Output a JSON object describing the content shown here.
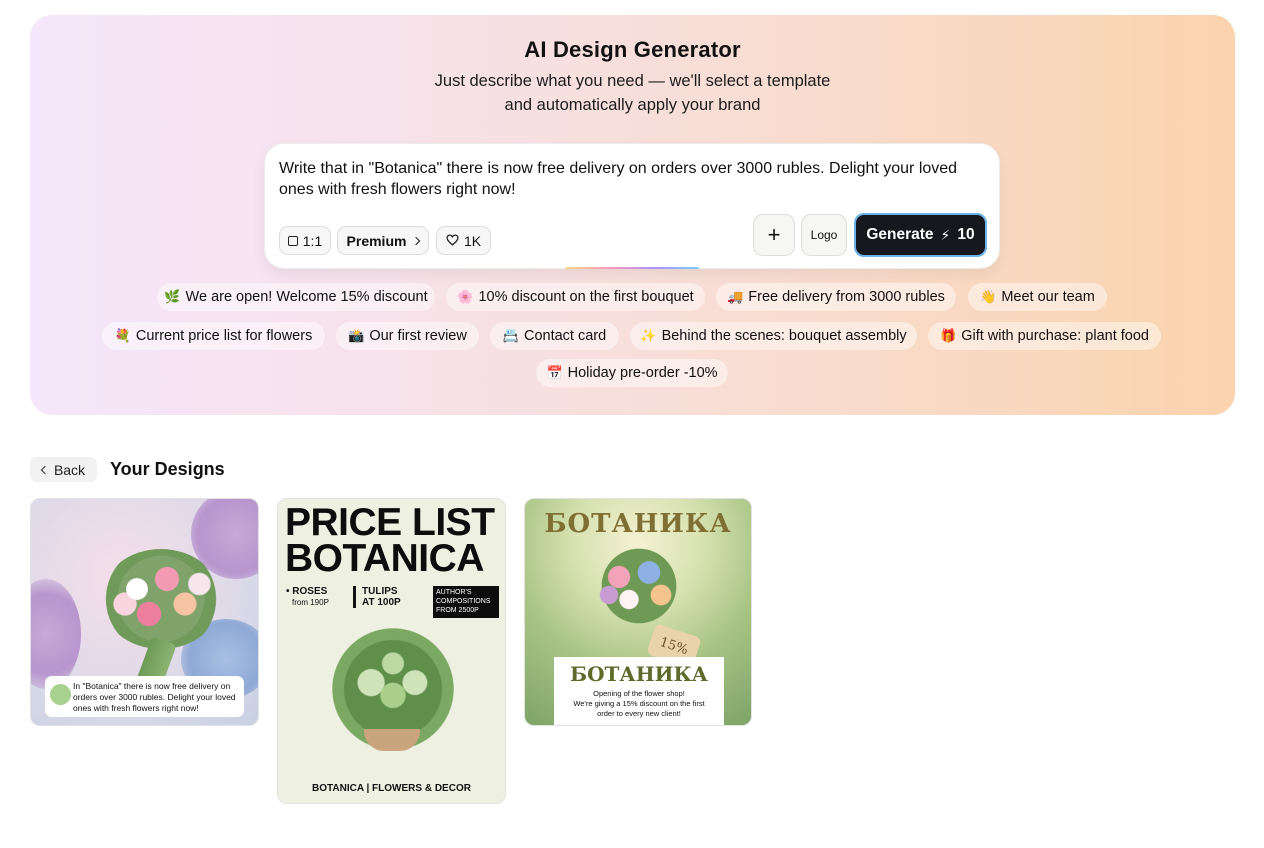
{
  "hero": {
    "title": "AI Design Generator",
    "subtitle_line1": "Just describe what you need — we'll select a template",
    "subtitle_line2": "and automatically apply your brand"
  },
  "prompt": {
    "text": "Write that in \"Botanica\" there is now free delivery on orders over 3000 rubles. Delight your loved ones with fresh flowers right now!",
    "ratio_label": "1:1",
    "plan_label": "Premium",
    "likes_label": "1K",
    "add_label": "+",
    "logo_label": "Logo",
    "generate_label": "Generate",
    "generate_cost": "10"
  },
  "chips": [
    {
      "emoji": "🌿",
      "label": "We are open! Welcome 15% discount"
    },
    {
      "emoji": "🌸",
      "label": "10% discount on the first bouquet"
    },
    {
      "emoji": "🚚",
      "label": "Free delivery from 3000 rubles"
    },
    {
      "emoji": "👋",
      "label": "Meet our team"
    },
    {
      "emoji": "💐",
      "label": "Current price list for flowers"
    },
    {
      "emoji": "📸",
      "label": "Our first review"
    },
    {
      "emoji": "📇",
      "label": "Contact card"
    },
    {
      "emoji": "✨",
      "label": "Behind the scenes: bouquet assembly"
    },
    {
      "emoji": "🎁",
      "label": "Gift with purchase: plant food"
    },
    {
      "emoji": "📅",
      "label": "Holiday pre-order -10%"
    }
  ],
  "designs": {
    "back_label": "Back",
    "title": "Your Designs",
    "card1": {
      "caption": "In \"Botanica\" there is now free delivery on orders over 3000 rubles. Delight your loved ones with fresh flowers right now!"
    },
    "card2": {
      "title_line1": "PRICE LIST",
      "title_line2": "BOTANICA",
      "roses": "• ROSES",
      "roses_price": "from 190P",
      "tulips": "TULIPS",
      "tulips_price": "AT 100P",
      "author_line1": "AUTHOR'S",
      "author_line2": "COMPOSITIONS",
      "author_line3": "FROM 2500P",
      "footer": "BOTANICA | FLOWERS & DECOR"
    },
    "card3": {
      "top_title": "БОТАНИКА",
      "tag": "15%",
      "name": "БОТАНИКА",
      "desc_line1": "Opening of the flower shop!",
      "desc_line2": "We're giving a 15% discount on the first",
      "desc_line3": "order to every new client!"
    }
  }
}
